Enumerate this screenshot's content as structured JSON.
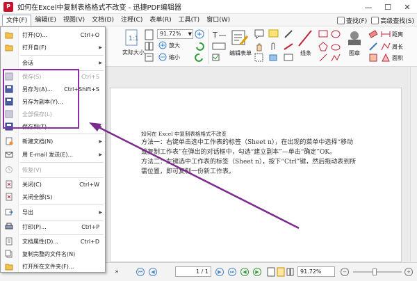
{
  "window": {
    "title": "如何在Excel中复制表格格式不改变 - 迅捷PDF编辑器",
    "minimize": "—",
    "maximize": "☐",
    "close": "✕"
  },
  "menubar": {
    "items": [
      "文件(F)",
      "编辑(E)",
      "视图(V)",
      "文档(D)",
      "注释(C)",
      "表单(R)",
      "工具(T)",
      "窗口(W)"
    ],
    "right": [
      "查找(F)",
      "高级查找(S)"
    ]
  },
  "ribbon": {
    "zoom_value": "91.72%",
    "labels": {
      "actual_size": "实际大小",
      "zoom_in": "放大",
      "zoom_out": "缩小",
      "edit_form": "编辑表单",
      "line": "线条",
      "stamp": "图章",
      "distance": "距离",
      "perimeter": "周长",
      "area": "面积"
    }
  },
  "file_menu": {
    "items": [
      {
        "label": "打开(O)...",
        "shortcut": "Ctrl+O",
        "arrow": false,
        "disabled": false
      },
      {
        "label": "打开自(F)",
        "shortcut": "",
        "arrow": true,
        "disabled": false
      },
      {
        "label": "会话",
        "shortcut": "",
        "arrow": true,
        "disabled": false
      },
      {
        "label": "保存(S)",
        "shortcut": "Ctrl+S",
        "arrow": false,
        "disabled": true
      },
      {
        "label": "另存为(A)...",
        "shortcut": "Ctrl+Shift+S",
        "arrow": false,
        "disabled": false
      },
      {
        "label": "另存为副本(Y)...",
        "shortcut": "",
        "arrow": false,
        "disabled": false
      },
      {
        "label": "全部保存(L)",
        "shortcut": "",
        "arrow": false,
        "disabled": true
      },
      {
        "label": "保存到(T)",
        "shortcut": "",
        "arrow": true,
        "disabled": false
      },
      {
        "label": "新建文档(N)",
        "shortcut": "",
        "arrow": true,
        "disabled": false
      },
      {
        "label": "用 E-mail 发送(E)...",
        "shortcut": "",
        "arrow": true,
        "disabled": false
      },
      {
        "label": "恢复(V)",
        "shortcut": "",
        "arrow": false,
        "disabled": true
      },
      {
        "label": "关闭(C)",
        "shortcut": "Ctrl+W",
        "arrow": false,
        "disabled": false
      },
      {
        "label": "关闭全部(S)",
        "shortcut": "",
        "arrow": false,
        "disabled": false
      },
      {
        "label": "导出",
        "shortcut": "",
        "arrow": true,
        "disabled": false
      },
      {
        "label": "打印(P)...",
        "shortcut": "Ctrl+P",
        "arrow": false,
        "disabled": false
      },
      {
        "label": "文档属性(D)...",
        "shortcut": "Ctrl+D",
        "arrow": false,
        "disabled": false
      },
      {
        "label": "复制完整的文件名(N)",
        "shortcut": "",
        "arrow": false,
        "disabled": false
      },
      {
        "label": "打开所在文件夹(F)...",
        "shortcut": "",
        "arrow": false,
        "disabled": false
      }
    ]
  },
  "document": {
    "title": "如何在 Excel 中复制表格格式不改变",
    "para1_line1": "方法一：右键单击选中工作表的标签（Sheet n），在出现的菜单中选择“移动",
    "para1_line2": "或复制工作表”在弹出的对话框中，勾选“建立副本”—单击“确定”OK。",
    "para2_line1": "方法二：左键选中工作表的标签（Sheet n），按下“Ctrl”键，然后拖动表到所",
    "para2_line2": "需位置，即可复制一份新工作表。"
  },
  "statusbar": {
    "page_value": "1 / 1",
    "zoom_value": "91.72%"
  },
  "colors": {
    "highlight": "#8b2fa0",
    "arrow": "#7b2a8e"
  }
}
